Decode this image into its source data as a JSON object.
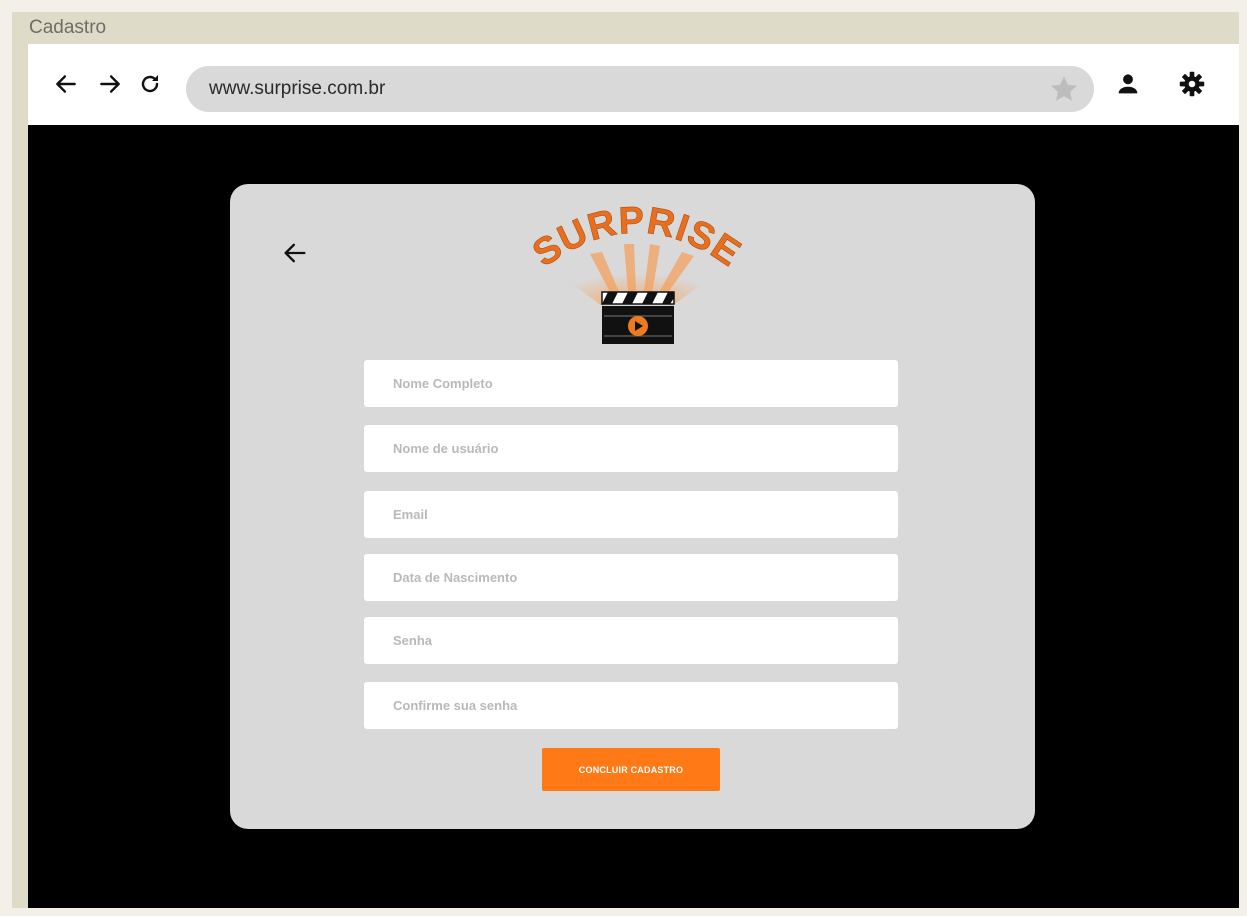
{
  "window": {
    "title": "Cadastro"
  },
  "browser": {
    "url": "www.surprise.com.br",
    "icons": {
      "back": "arrow-left-icon",
      "forward": "arrow-right-icon",
      "reload": "reload-icon",
      "bookmark": "star-icon",
      "profile": "user-icon",
      "settings": "gear-icon"
    }
  },
  "signup": {
    "logo_text": "SURPRISE",
    "fields": {
      "full_name": "Nome Completo",
      "username": "Nome de usuário",
      "email": "Email",
      "birth_date": "Data de Nascimento",
      "password": "Senha",
      "confirm_password": "Confirme sua senha"
    },
    "submit_label": "CONCLUIR CADASTRO"
  },
  "colors": {
    "accent": "#ff7a16",
    "card": "#d9d9d9",
    "stage": "#000000",
    "logo_orange": "#e86f1f"
  }
}
